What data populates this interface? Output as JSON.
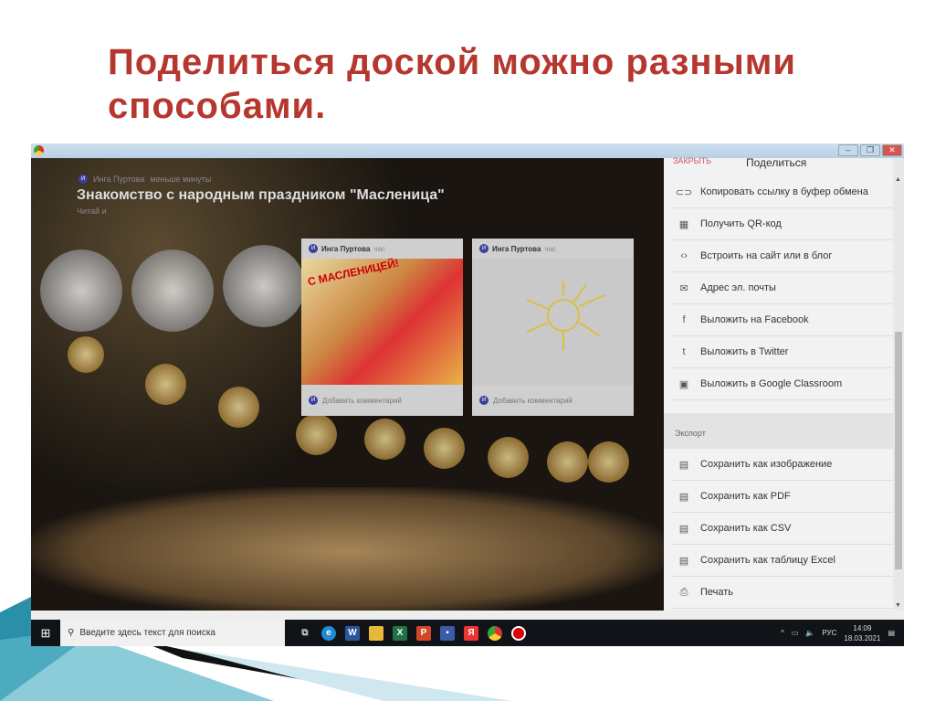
{
  "slide": {
    "title": "Поделиться доской  можно разными способами."
  },
  "board": {
    "author": "Инга Пуртова",
    "time": "меньше минуты",
    "title": "Знакомство с народным праздником \"Масленица\"",
    "subtitle": "Читай и"
  },
  "cards": [
    {
      "author": "Инга Пуртова",
      "time": "час",
      "image_caption": "С МАСЛЕНИЦЕЙ!",
      "comment": "Добавить комментарий"
    },
    {
      "author": "Инга Пуртова",
      "time": "час",
      "comment": "Добавить комментарий"
    }
  ],
  "share_panel": {
    "close": "ЗАКРЫТЬ",
    "title": "Поделиться",
    "items": [
      {
        "icon": "link-icon",
        "glyph": "⊂⊃",
        "label": "Копировать ссылку в буфер обмена"
      },
      {
        "icon": "qr-code-icon",
        "glyph": "▦",
        "label": "Получить QR-код"
      },
      {
        "icon": "embed-code-icon",
        "glyph": "‹›",
        "label": "Встроить на сайт или в блог"
      },
      {
        "icon": "email-icon",
        "glyph": "✉",
        "label": "Адрес эл. почты"
      },
      {
        "icon": "facebook-icon",
        "glyph": "f",
        "label": "Выложить на Facebook"
      },
      {
        "icon": "twitter-icon",
        "glyph": "t",
        "label": "Выложить в Twitter"
      },
      {
        "icon": "google-classroom-icon",
        "glyph": "▣",
        "label": "Выложить в Google Classroom"
      }
    ],
    "export_label": "Экспорт",
    "export_items": [
      {
        "icon": "image-file-icon",
        "glyph": "▤",
        "label": "Сохранить как изображение"
      },
      {
        "icon": "pdf-file-icon",
        "glyph": "▤",
        "label": "Сохранить как PDF"
      },
      {
        "icon": "csv-file-icon",
        "glyph": "▤",
        "label": "Сохранить как CSV"
      },
      {
        "icon": "excel-file-icon",
        "glyph": "▤",
        "label": "Сохранить как таблицу Excel"
      },
      {
        "icon": "print-icon",
        "glyph": "⎙",
        "label": "Печать"
      }
    ]
  },
  "taskbar": {
    "search_placeholder": "Введите здесь текст для поиска",
    "language": "РУС",
    "time": "14:09",
    "date": "18.03.2021"
  }
}
